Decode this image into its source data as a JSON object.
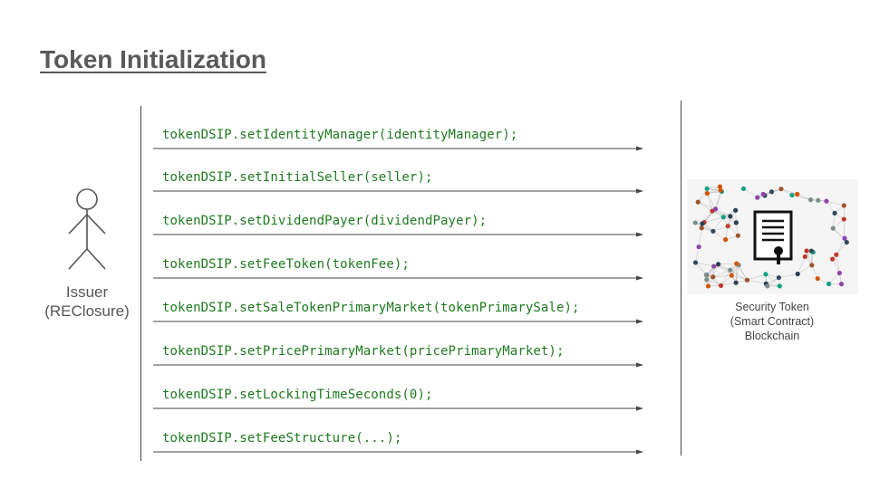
{
  "title": "Token Initialization",
  "issuer": {
    "name": "Issuer",
    "org": "(REClosure)",
    "icon": "stick-figure-icon"
  },
  "messages": [
    "tokenDSIP.setIdentityManager(identityManager);",
    "tokenDSIP.setInitialSeller(seller);",
    "tokenDSIP.setDividendPayer(dividendPayer);",
    "tokenDSIP.setFeeToken(tokenFee);",
    "tokenDSIP.setSaleTokenPrimaryMarket(tokenPrimarySale);",
    "tokenDSIP.setPricePrimaryMarket(pricePrimaryMarket);",
    "tokenDSIP.setLockingTimeSeconds(0);",
    "tokenDSIP.setFeeStructure(...);"
  ],
  "contract": {
    "line1": "Security Token",
    "line2": "(Smart Contract)",
    "line3": "Blockchain",
    "icon": "contract-document-icon"
  },
  "colors": {
    "code_text": "#1e7a1e",
    "title": "#595959",
    "arrow": "#444444"
  }
}
